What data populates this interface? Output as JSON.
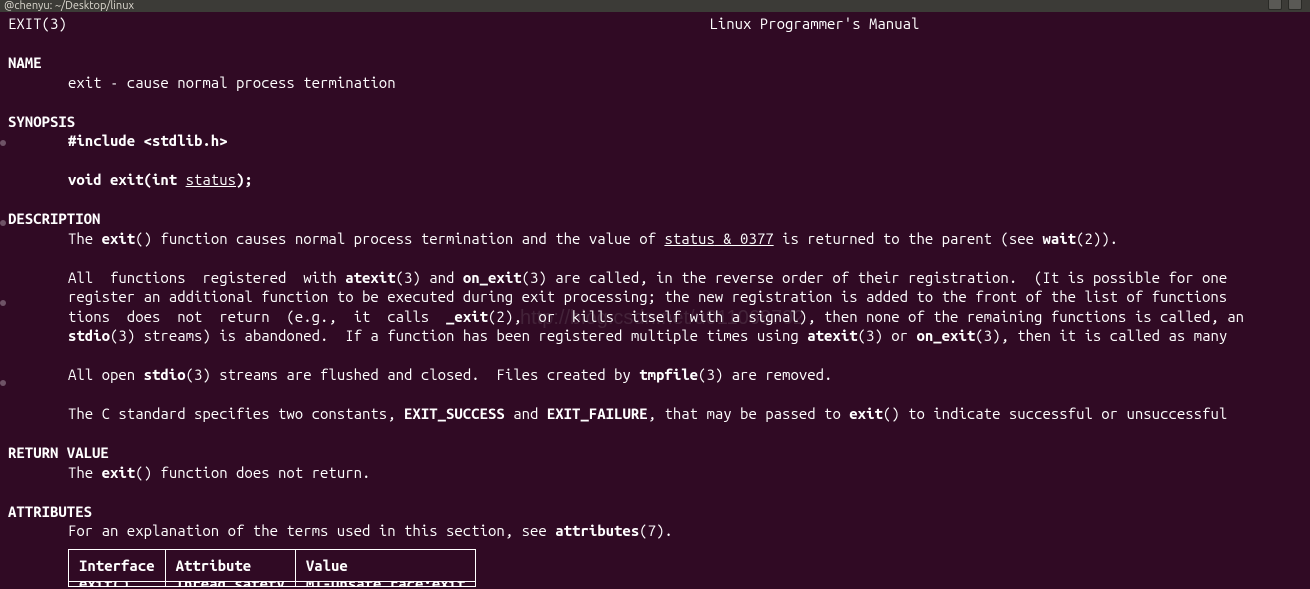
{
  "titlebar": {
    "text": "@chenyu: ~/Desktop/linux"
  },
  "header": {
    "left": "EXIT(3)",
    "center": "Linux Programmer's Manual"
  },
  "sections": {
    "name_head": "NAME",
    "name_text": "exit - cause normal process termination",
    "synopsis_head": "SYNOPSIS",
    "synopsis_include": "#include <stdlib.h>",
    "synopsis_proto_pre": "void exit(int ",
    "synopsis_proto_arg": "status",
    "synopsis_proto_post": ");",
    "description_head": "DESCRIPTION",
    "desc_l1_a": "The ",
    "desc_l1_b": "exit",
    "desc_l1_c": "() function causes normal process termination and the value of ",
    "desc_l1_d": "status",
    "desc_l1_e": " & ",
    "desc_l1_f": "0377",
    "desc_l1_g": " is returned to the parent (see ",
    "desc_l1_h": "wait",
    "desc_l1_i": "(2)).",
    "desc_l2_a": "All  functions  registered  with ",
    "desc_l2_b": "atexit",
    "desc_l2_c": "(3) and ",
    "desc_l2_d": "on_exit",
    "desc_l2_e": "(3) are called, in the reverse order of their registration.  (It is possible for one",
    "desc_l3": "register an additional function to be executed during exit processing; the new registration is added to the front of the list of functions",
    "desc_l4_a": "tions  does  not  return  (e.g.,  it  calls  ",
    "desc_l4_b": "_exit",
    "desc_l4_c": "(2),  or  kills  itself with a signal), then none of the remaining functions is called, an",
    "desc_l5_a": "stdio",
    "desc_l5_b": "(3) streams) is abandoned.  If a function has been registered multiple times using ",
    "desc_l5_c": "atexit",
    "desc_l5_d": "(3) or ",
    "desc_l5_e": "on_exit",
    "desc_l5_f": "(3), then it is called as many",
    "desc_l6_a": "All open ",
    "desc_l6_b": "stdio",
    "desc_l6_c": "(3) streams are flushed and closed.  Files created by ",
    "desc_l6_d": "tmpfile",
    "desc_l6_e": "(3) are removed.",
    "desc_l7_a": "The C standard specifies two constants, ",
    "desc_l7_b": "EXIT_SUCCESS",
    "desc_l7_c": " and ",
    "desc_l7_d": "EXIT_FAILURE",
    "desc_l7_e": ", that may be passed to ",
    "desc_l7_f": "exit",
    "desc_l7_g": "() to indicate successful or unsuccessful",
    "return_head": "RETURN VALUE",
    "return_l1_a": "The ",
    "return_l1_b": "exit",
    "return_l1_c": "() function does not return.",
    "attr_head": "ATTRIBUTES",
    "attr_l1_a": "For an explanation of the terms used in this section, see ",
    "attr_l1_b": "attributes",
    "attr_l1_c": "(7)."
  },
  "table": {
    "h1": "Interface",
    "h2": "Attribute",
    "h3": "Value",
    "r1c1": "exit()",
    "r1c2": "Thread safety",
    "r1c3": "MT-Unsafe race:exit"
  },
  "watermark": "http://blog.csdn.net/u011068702"
}
